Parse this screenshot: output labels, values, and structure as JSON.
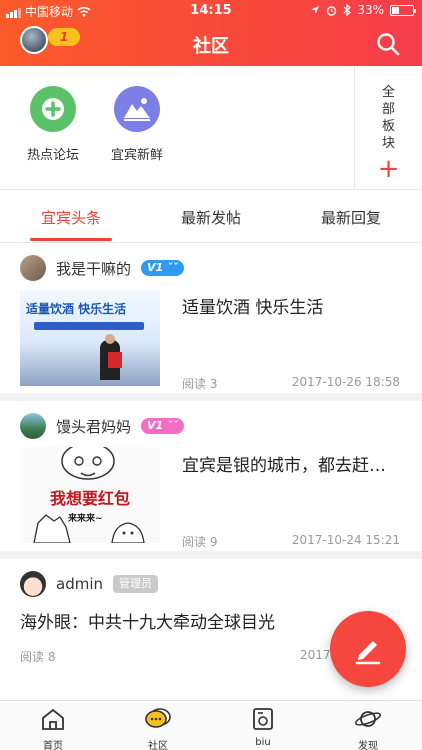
{
  "status_bar": {
    "carrier": "中国移动",
    "time": "14:15",
    "battery": "33%"
  },
  "header": {
    "badge": "1",
    "title": "社区"
  },
  "quick_sections": [
    {
      "label": "热点论坛",
      "icon": "plus-icon",
      "color": "#5cc26a"
    },
    {
      "label": "宜宾新鲜",
      "icon": "mountain-icon",
      "color": "#7b7fe6"
    }
  ],
  "all_boards": {
    "label": "全部板块",
    "plus": "+"
  },
  "tabs": [
    {
      "label": "宜宾头条",
      "active": true
    },
    {
      "label": "最新发帖",
      "active": false
    },
    {
      "label": "最新回复",
      "active": false
    }
  ],
  "posts": [
    {
      "author": "我是干嘛的",
      "level": "V1 ˇˇ",
      "level_color": "#2e9bf0",
      "title": "适量饮酒 快乐生活",
      "reads": "阅读 3",
      "date": "2017-10-26 18:58",
      "thumb_text": "适量饮酒 快乐生活"
    },
    {
      "author": "馒头君妈妈",
      "level": "V1 ˇˇ",
      "level_color": "#f56cc4",
      "title": "宜宾是银的城市，都去赶…",
      "reads": "阅读 9",
      "date": "2017-10-24 15:21",
      "thumb_text": "我想要红包",
      "thumb_text2": "来来来~"
    },
    {
      "author": "admin",
      "role": "管理员",
      "title": "海外眼：中共十九大牵动全球目光",
      "reads": "阅读 8",
      "date": "2017-"
    }
  ],
  "bottom_nav": [
    {
      "label": "首页",
      "icon": "home-icon"
    },
    {
      "label": "社区",
      "icon": "chat-bubble-icon"
    },
    {
      "label": "biu",
      "icon": "biu-box-icon"
    },
    {
      "label": "发现",
      "icon": "planet-icon"
    }
  ],
  "colors": {
    "accent": "#f0413a",
    "header_start": "#fb5a2b",
    "header_end": "#f53d4b"
  }
}
